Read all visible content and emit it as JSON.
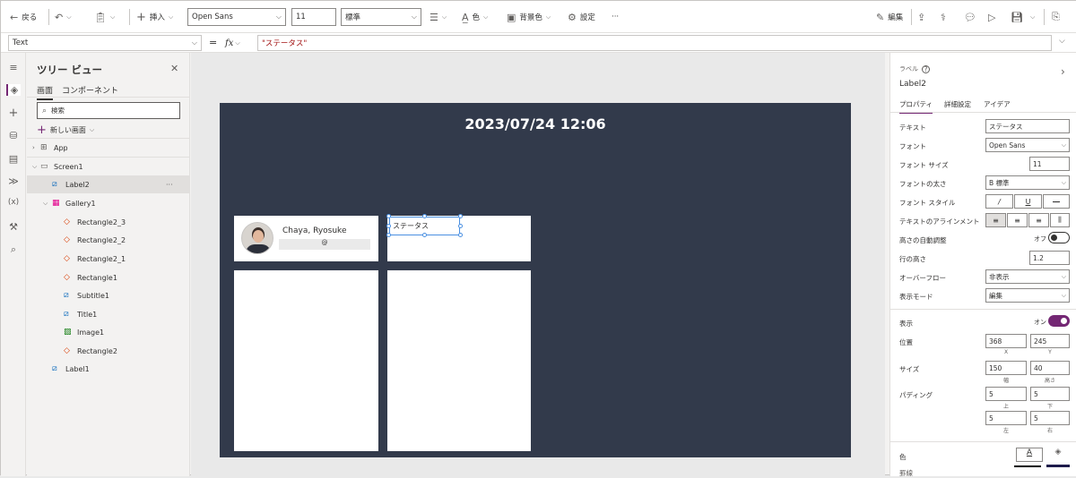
{
  "toolbar": {
    "back_label": "戻る",
    "insert_label": "挿入",
    "font_value": "Open Sans",
    "font_size_value": "11",
    "weight_value": "標準",
    "color_label": "色",
    "fill_label": "背景色",
    "settings_label": "設定",
    "more_label": "···",
    "edit_label": "編集"
  },
  "formula_bar": {
    "property_value": "Text",
    "equals": "=",
    "fx_label": "fx",
    "formula_value": "\"ステータス\""
  },
  "tree": {
    "title": "ツリー ビュー",
    "tab_screens": "画面",
    "tab_components": "コンポーネント",
    "search_placeholder": "検索",
    "new_screen_label": "新しい画面",
    "items": [
      {
        "label": "App"
      },
      {
        "label": "Screen1"
      },
      {
        "label": "Label2"
      },
      {
        "label": "Gallery1"
      },
      {
        "label": "Rectangle2_3"
      },
      {
        "label": "Rectangle2_2"
      },
      {
        "label": "Rectangle2_1"
      },
      {
        "label": "Rectangle1"
      },
      {
        "label": "Subtitle1"
      },
      {
        "label": "Title1"
      },
      {
        "label": "Image1"
      },
      {
        "label": "Rectangle2"
      },
      {
        "label": "Label1"
      }
    ],
    "item_more": "···"
  },
  "canvas": {
    "datetime": "2023/07/24 12:06",
    "card_name": "Chaya, Ryosuke",
    "card_sub": "@",
    "status_label": "ステータス"
  },
  "props": {
    "type_label": "ラベル",
    "control_name": "Label2",
    "tab_properties": "プロパティ",
    "tab_advanced": "詳細設定",
    "tab_ideas": "アイデア",
    "text_label": "テキスト",
    "text_value": "ステータス",
    "font_label": "フォント",
    "font_value": "Open Sans",
    "size_label": "フォント サイズ",
    "size_value": "11",
    "weight_label": "フォントの太さ",
    "weight_value": "B 標準",
    "style_label": "フォント スタイル",
    "align_label": "テキストのアラインメント",
    "autoheight_label": "高さの自動調整",
    "autoheight_value": "オフ",
    "lineheight_label": "行の高さ",
    "lineheight_value": "1.2",
    "overflow_label": "オーバーフロー",
    "overflow_value": "非表示",
    "mode_label": "表示モード",
    "mode_value": "編集",
    "visible_label": "表示",
    "visible_value": "オン",
    "position_label": "位置",
    "pos_x": "368",
    "pos_y": "245",
    "x_label": "X",
    "y_label": "Y",
    "size2_label": "サイズ",
    "width": "150",
    "height": "40",
    "width_label": "幅",
    "height_label": "高さ",
    "padding_label": "パディング",
    "pad_top": "5",
    "pad_bottom": "5",
    "pad_left": "5",
    "pad_right": "5",
    "top_label": "上",
    "bottom_label": "下",
    "left_label": "左",
    "right_label": "右",
    "color_label": "色",
    "border_label": "罫線"
  },
  "colors": {
    "accent": "#742774",
    "screen_bg": "#323a4b",
    "selection": "#4a90e2"
  }
}
